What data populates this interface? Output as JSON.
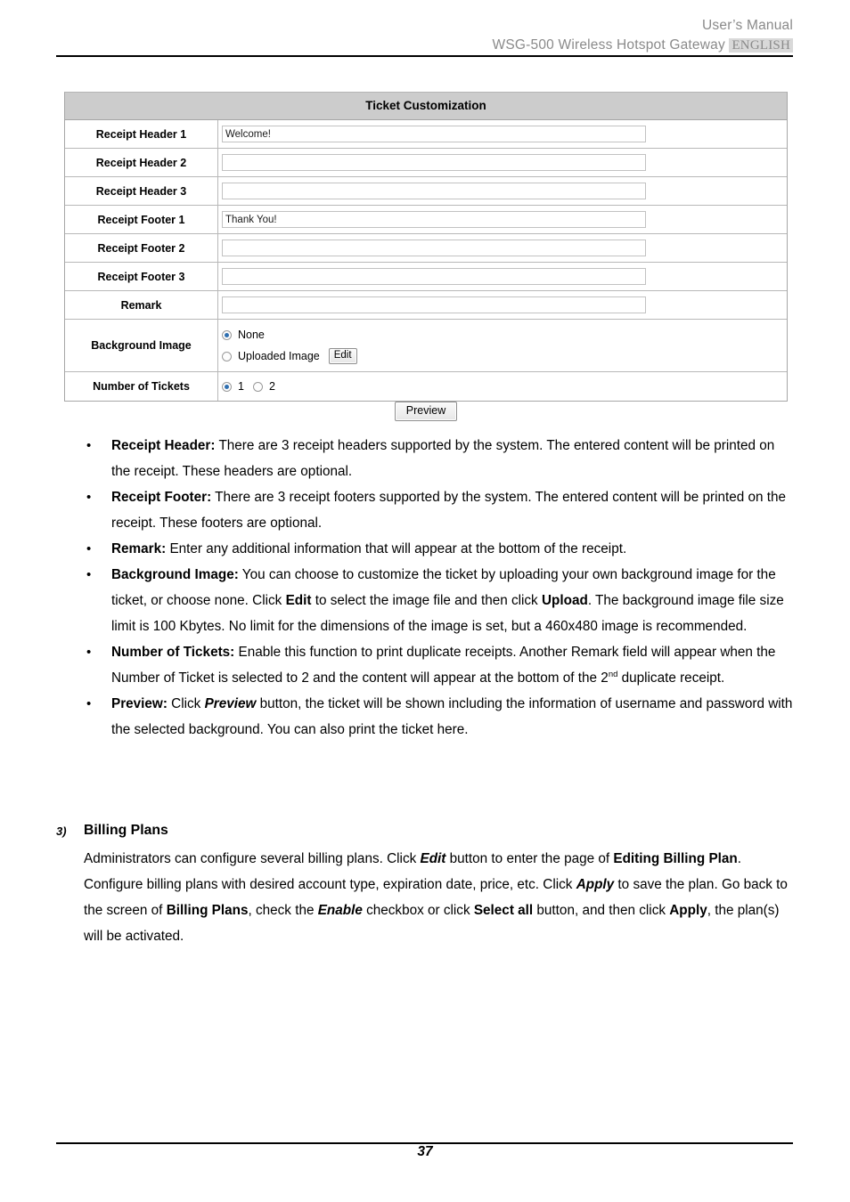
{
  "header": {
    "line1": "User’s Manual",
    "line2_prefix": "WSG-500 Wireless Hotspot Gateway ",
    "language_badge": "ENGLISH"
  },
  "panel": {
    "title": "Ticket Customization",
    "rows": [
      {
        "label": "Receipt Header 1",
        "value": "Welcome!"
      },
      {
        "label": "Receipt Header 2",
        "value": ""
      },
      {
        "label": "Receipt Header 3",
        "value": ""
      },
      {
        "label": "Receipt Footer 1",
        "value": "Thank You!"
      },
      {
        "label": "Receipt Footer 2",
        "value": ""
      },
      {
        "label": "Receipt Footer 3",
        "value": ""
      },
      {
        "label": "Remark",
        "value": ""
      }
    ],
    "background_image": {
      "label": "Background Image",
      "option_none": "None",
      "option_uploaded": "Uploaded Image",
      "edit_button": "Edit",
      "selected": "None"
    },
    "number_of_tickets": {
      "label": "Number of Tickets",
      "option_1": "1",
      "option_2": "2",
      "selected": "1"
    },
    "preview_button": "Preview"
  },
  "bullets": [
    {
      "term": "Receipt Header:",
      "text": " There are 3 receipt headers supported by the system. The entered content will be printed on the receipt. These headers are optional."
    },
    {
      "term": "Receipt Footer:",
      "text": " There are 3 receipt footers supported by the system. The entered content will be printed on the receipt. These footers are optional."
    },
    {
      "term": "Remark:",
      "text": " Enter any additional information that will appear at the bottom of the receipt."
    },
    {
      "term": "Background Image:",
      "text_a": " You can choose to customize the ticket by uploading your own background image for the ticket, or choose none. Click ",
      "emph_a": "Edit",
      "text_b": " to select the image file and then click ",
      "emph_b": "Upload",
      "text_c": ". The background image file size limit is 100 Kbytes. No limit for the dimensions of the image is set, but a 460x480 image is recommended."
    },
    {
      "term": "Number of Tickets:",
      "text_a": " Enable this function to print duplicate receipts. Another Remark field will appear when the Number of Ticket is selected to 2 and the content will appear at the bottom of the 2",
      "superscript": "nd",
      "text_b": " duplicate receipt."
    },
    {
      "term": "Preview:",
      "text_a": " Click ",
      "emph_a": "Preview",
      "text_b": " button, the ticket will be shown including the information of username and password with the selected background. You can also print the ticket here."
    }
  ],
  "section": {
    "number": "3)",
    "heading": "Billing Plans",
    "para_1": "Administrators can configure several billing plans. Click ",
    "emph_1": "Edit",
    "para_2": " button to enter the page of ",
    "emph_2": "Editing Billing Plan",
    "para_3": ". Configure billing plans with desired account type, expiration date, price, etc. Click ",
    "emph_3": "Apply",
    "para_4": " to save the plan. Go back to the screen of ",
    "emph_4": "Billing Plans",
    "para_5": ", check the ",
    "emph_5": "Enable",
    "para_6": " checkbox or click ",
    "emph_6": "Select all",
    "para_7": " button, and then click ",
    "emph_7": "Apply",
    "para_8": ", the plan(s) will be activated."
  },
  "footer": {
    "page_number": "37"
  },
  "colors": {
    "panel_header_bg": "#cccccc",
    "header_text": "#8a8a8a",
    "badge_bg": "#d9d9d9",
    "radio_dot": "#2f6fb0",
    "border": "#b8b8b8"
  }
}
